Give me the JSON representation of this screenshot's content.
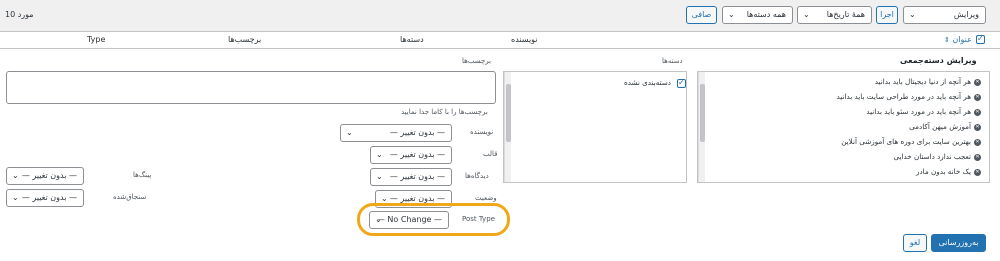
{
  "toolbar": {
    "item_count": "10 مورد",
    "bulk_action": "ویرایش",
    "apply_label": "اجرا",
    "dates_filter": "همهٔ تاریخ‌ها",
    "category_filter": "همه دسته‌ها",
    "filter_label": "صافی"
  },
  "columns": {
    "title": "عنوان",
    "author": "نویسنده",
    "categories": "دسته‌ها",
    "tags": "برچسب‌ها",
    "type": "Type"
  },
  "bulk_edit": {
    "heading": "ویرایش دسته‌جمعی",
    "posts": [
      "هر آنچه از دنیا دیجیتال باید بدانید",
      "هر آنچه باید در مورد طراحی سایت باید بدانید",
      "هر آنچه باید در مورد سئو باید بدانید",
      "آموزش میهن آکادمی",
      "بهترین سایت برای دوره های آموزشی آنلاین",
      "تعجب ندارد داستان خدایی",
      "یک خانه بدون مادر"
    ],
    "categories_label": "دسته‌ها",
    "category_option": "دسته‌بندی نشده",
    "tags_label": "برچسب‌ها",
    "tags_hint": "برچسب‌ها را با کاما جدا نمایید",
    "fields": {
      "author_label": "نویسنده",
      "author_value": "— بدون تغییر —",
      "template_label": "قالب",
      "template_value": "— بدون تغییر —",
      "comments_label": "دیدگاه‌ها",
      "comments_value": "— بدون تغییر —",
      "status_label": "وضعیت",
      "status_value": "— بدون تغییر —",
      "post_type_label": "Post Type",
      "post_type_value": "— No Change —",
      "pings_label": "پینگ‌ها",
      "pings_value": "— بدون تغییر —",
      "sticky_label": "سنجاق‌شده",
      "sticky_value": "— بدون تغییر —"
    },
    "update_label": "به‌روزرسانی",
    "cancel_label": "لغو"
  },
  "colors": {
    "accent": "#2271b1",
    "highlight": "#f0a818"
  }
}
